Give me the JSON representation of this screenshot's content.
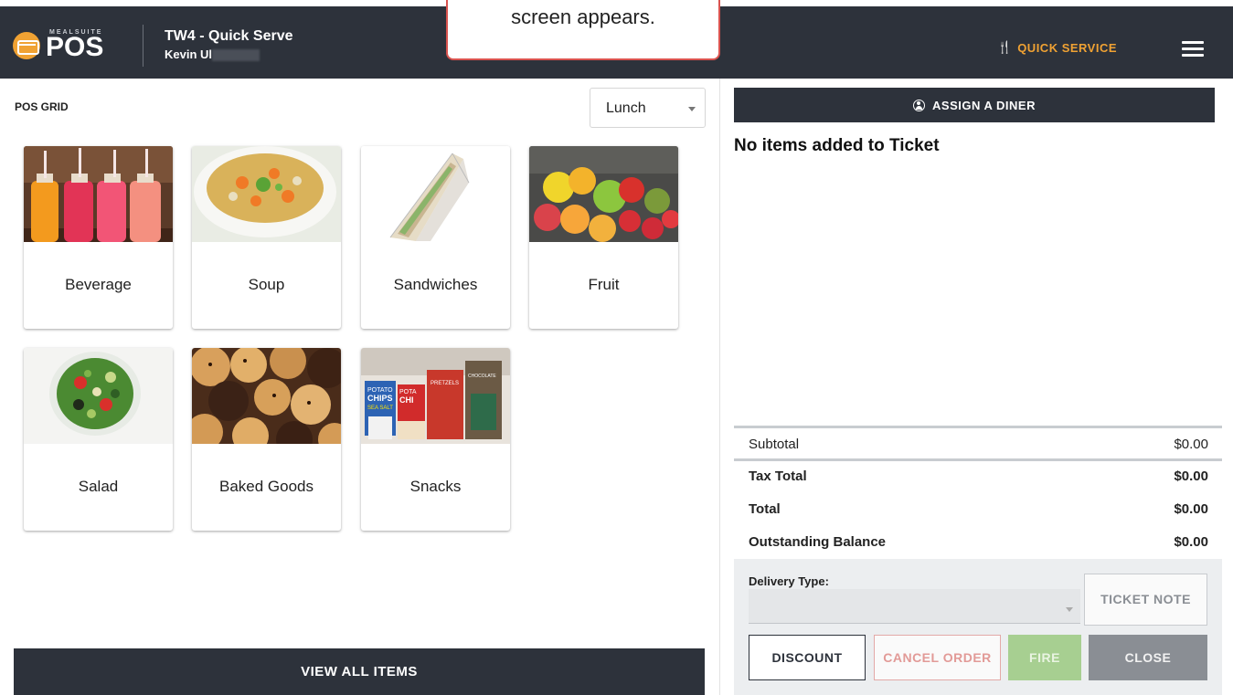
{
  "header": {
    "logo_small": "MEALSUITE",
    "logo_text": "POS",
    "store_title": "TW4 - Quick Serve",
    "user_name": "Kevin Ul",
    "mode_label": "QUICK SERVICE",
    "mode_icon": "fork-knife-icon",
    "menu_icon": "hamburger-icon"
  },
  "callout": {
    "text": "screen appears."
  },
  "grid": {
    "title": "POS GRID",
    "meal_period": "Lunch",
    "tiles": [
      {
        "label": "Beverage"
      },
      {
        "label": "Soup"
      },
      {
        "label": "Sandwiches"
      },
      {
        "label": "Fruit"
      },
      {
        "label": "Salad"
      },
      {
        "label": "Baked Goods"
      },
      {
        "label": "Snacks"
      }
    ],
    "snack_packs": [
      "POTATO",
      "CHIPS",
      "SEA SALT",
      "POTA",
      "CHI",
      "PRETZELS",
      "CHOCOLATE"
    ],
    "view_all_label": "VIEW ALL ITEMS"
  },
  "ticket": {
    "assign_label": "ASSIGN A DINER",
    "empty_message": "No items added to Ticket",
    "summary": {
      "subtotal_label": "Subtotal",
      "subtotal_value": "$0.00",
      "tax_label": "Tax Total",
      "tax_value": "$0.00",
      "total_label": "Total",
      "total_value": "$0.00",
      "balance_label": "Outstanding Balance",
      "balance_value": "$0.00"
    },
    "delivery_type_label": "Delivery Type:",
    "delivery_type_value": "",
    "buttons": {
      "ticket_note": "TICKET NOTE",
      "discount": "DISCOUNT",
      "cancel_order": "CANCEL ORDER",
      "fire": "FIRE",
      "close": "CLOSE"
    }
  },
  "colors": {
    "header_bg": "#2d323b",
    "accent": "#f0a233",
    "fire_green": "#a7cf91",
    "cancel_red": "#e29a97",
    "close_gray": "#8a8e94"
  }
}
